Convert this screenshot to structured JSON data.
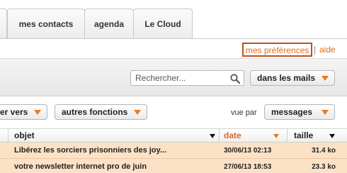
{
  "tabs": [
    {
      "label": "mes contacts"
    },
    {
      "label": "agenda"
    },
    {
      "label": "Le Cloud"
    }
  ],
  "links": {
    "preferences": "mes préférences",
    "separator": "|",
    "help": "aide"
  },
  "search": {
    "placeholder": "Rechercher...",
    "value": "",
    "scope": "dans les mails"
  },
  "toolbar": {
    "move_label": "er vers",
    "other_label": "autres fonctions",
    "view_by_label": "vue par",
    "view_value": "messages"
  },
  "columns": {
    "subject": "objet",
    "date": "date",
    "size": "taille"
  },
  "messages": [
    {
      "subject": "Libérez les sorciers prisonniers des joy...",
      "date": "30/06/13 02:13",
      "size": "31.4 ko"
    },
    {
      "subject": "votre newsletter internet pro de juin",
      "date": "27/06/13 18:53",
      "size": "23.3 ko"
    }
  ],
  "colors": {
    "accent": "#d96c1f",
    "row_highlight": "#fbe2c6",
    "caret": "#e87a1e"
  },
  "icons": {
    "search": "magnifier-icon",
    "dropdown": "caret-down-icon"
  }
}
